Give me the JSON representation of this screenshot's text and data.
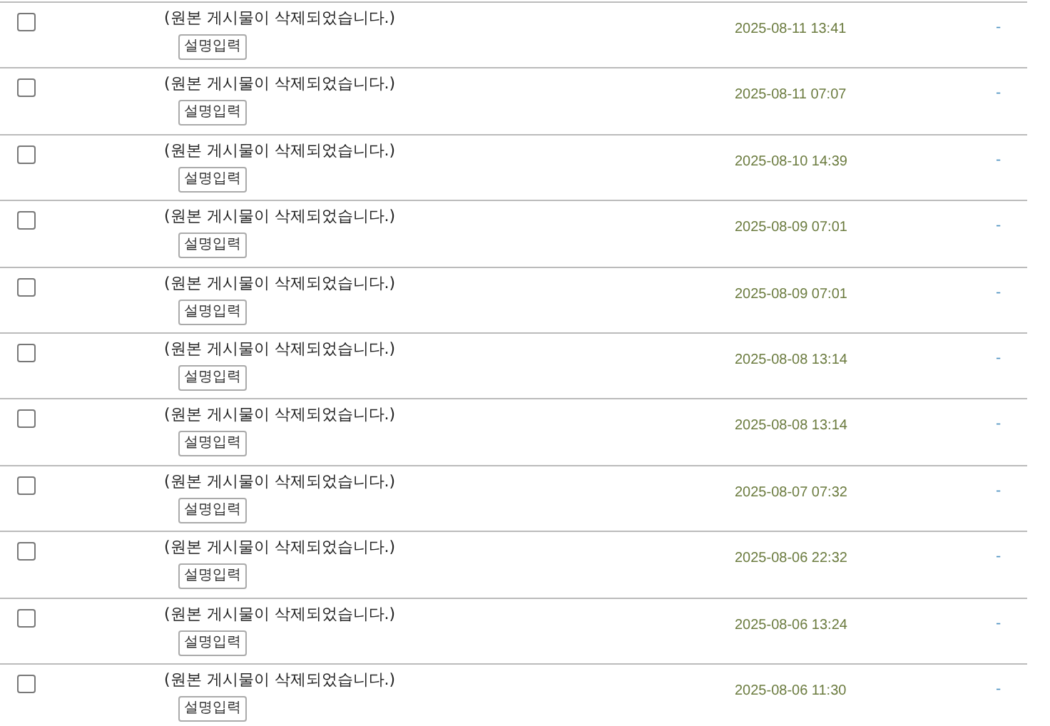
{
  "rows": [
    {
      "checked": false,
      "title": "(원본 게시물이 삭제되었습니다.)",
      "button": "설명입력",
      "date": "2025-08-11 13:41",
      "extra": "-"
    },
    {
      "checked": false,
      "title": "(원본 게시물이 삭제되었습니다.)",
      "button": "설명입력",
      "date": "2025-08-11 07:07",
      "extra": "-"
    },
    {
      "checked": false,
      "title": "(원본 게시물이 삭제되었습니다.)",
      "button": "설명입력",
      "date": "2025-08-10 14:39",
      "extra": "-"
    },
    {
      "checked": false,
      "title": "(원본 게시물이 삭제되었습니다.)",
      "button": "설명입력",
      "date": "2025-08-09 07:01",
      "extra": "-"
    },
    {
      "checked": false,
      "title": "(원본 게시물이 삭제되었습니다.)",
      "button": "설명입력",
      "date": "2025-08-09 07:01",
      "extra": "-"
    },
    {
      "checked": false,
      "title": "(원본 게시물이 삭제되었습니다.)",
      "button": "설명입력",
      "date": "2025-08-08 13:14",
      "extra": "-"
    },
    {
      "checked": false,
      "title": "(원본 게시물이 삭제되었습니다.)",
      "button": "설명입력",
      "date": "2025-08-08 13:14",
      "extra": "-"
    },
    {
      "checked": false,
      "title": "(원본 게시물이 삭제되었습니다.)",
      "button": "설명입력",
      "date": "2025-08-07 07:32",
      "extra": "-"
    },
    {
      "checked": false,
      "title": "(원본 게시물이 삭제되었습니다.)",
      "button": "설명입력",
      "date": "2025-08-06 22:32",
      "extra": "-"
    },
    {
      "checked": false,
      "title": "(원본 게시물이 삭제되었습니다.)",
      "button": "설명입력",
      "date": "2025-08-06 13:24",
      "extra": "-"
    },
    {
      "checked": false,
      "title": "(원본 게시물이 삭제되었습니다.)",
      "button": "설명입력",
      "date": "2025-08-06 11:30",
      "extra": "-"
    }
  ]
}
